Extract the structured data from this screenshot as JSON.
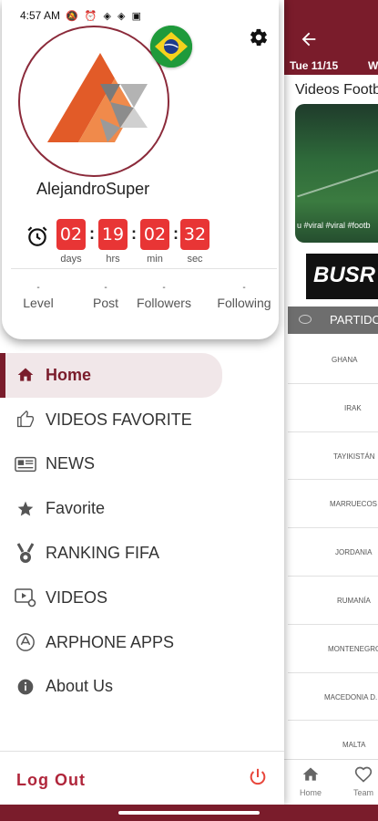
{
  "status_bar": {
    "time": "4:57 AM",
    "icons": "🔕 ⏰ ◈ ◈ ▣"
  },
  "background_app": {
    "back_icon": "arrow-left-icon",
    "tab_date": "Tue 11/15",
    "tab_next": "W",
    "section_title": "Videos Footb",
    "video_caption": "u #viral #viral #footb",
    "banner_text": "BUSR",
    "section_header": "PARTIDO",
    "matches": [
      "GHANA",
      "IRAK",
      "TAYIKISTÁN",
      "MARRUECOS",
      "JORDANIA",
      "RUMANÍA",
      "MONTENEGRO",
      "MACEDONIA D.",
      "MALTA"
    ],
    "bottom_nav": [
      {
        "label": "Home",
        "icon": "home-icon"
      },
      {
        "label": "Team",
        "icon": "heart-icon"
      }
    ]
  },
  "profile": {
    "username": "AlejandroSuper",
    "flag": "brazil-flag",
    "settings_icon": "gear-icon",
    "countdown": {
      "days": "02",
      "hrs": "19",
      "min": "02",
      "sec": "32",
      "labels": {
        "days": "days",
        "hrs": "hrs",
        "min": "min",
        "sec": "sec"
      }
    },
    "stats": [
      {
        "label": "Level",
        "value": "-"
      },
      {
        "label": "Post",
        "value": "-"
      },
      {
        "label": "Followers",
        "value": "-"
      },
      {
        "label": "Following",
        "value": "-"
      }
    ]
  },
  "menu": [
    {
      "label": "Home",
      "icon": "home-icon",
      "active": true
    },
    {
      "label": "VIDEOS FAVORITE",
      "icon": "thumbs-up-icon"
    },
    {
      "label": "NEWS",
      "icon": "newspaper-icon"
    },
    {
      "label": "Favorite",
      "icon": "star-icon"
    },
    {
      "label": "RANKING FIFA",
      "icon": "medal-icon"
    },
    {
      "label": "VIDEOS",
      "icon": "video-settings-icon"
    },
    {
      "label": "ARPHONE APPS",
      "icon": "app-store-icon"
    },
    {
      "label": "About Us",
      "icon": "info-icon"
    }
  ],
  "logout": {
    "label": "Log Out",
    "icon": "power-icon"
  },
  "colors": {
    "brand": "#7a1c2b",
    "timer": "#e83535",
    "logout": "#b0263b",
    "power": "#e8473c"
  }
}
